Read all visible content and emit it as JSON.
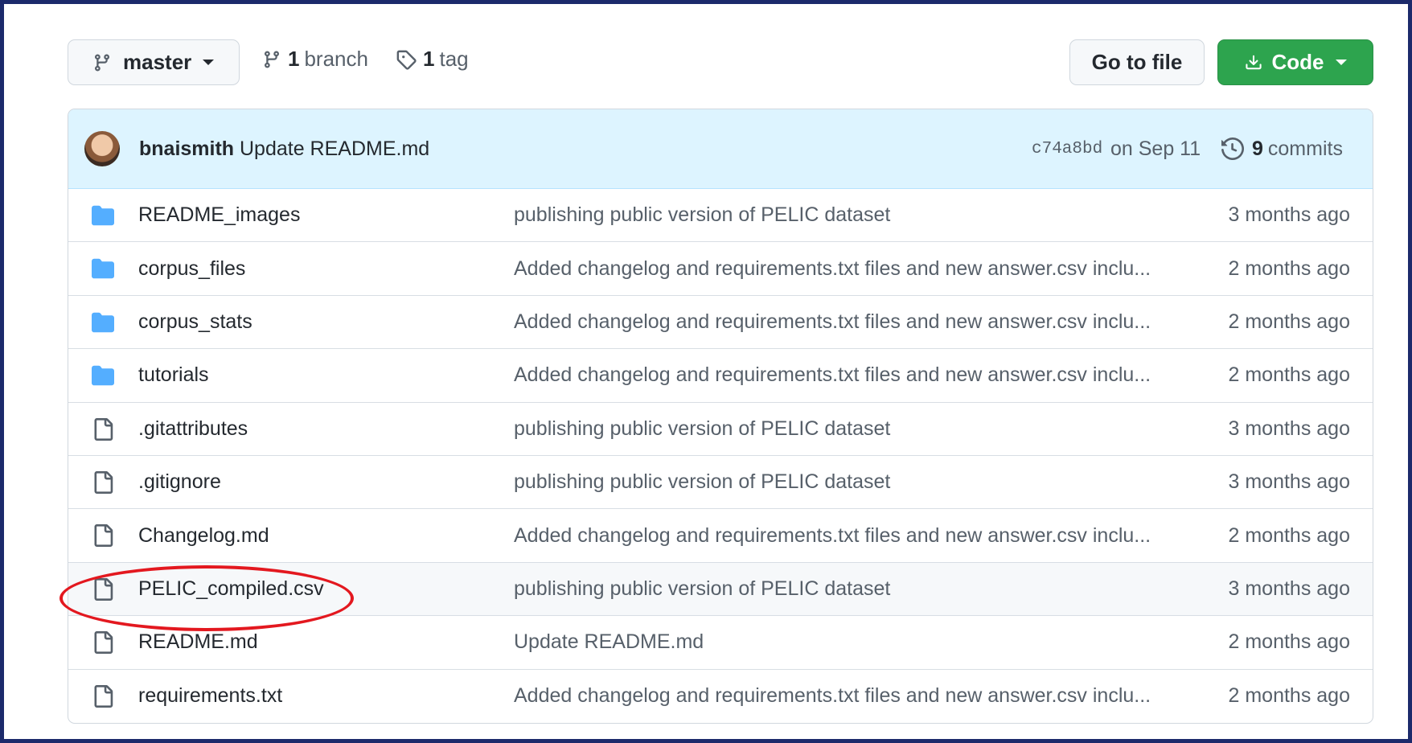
{
  "toolbar": {
    "branch_name": "master",
    "branch_count": "1",
    "branch_label": "branch",
    "tag_count": "1",
    "tag_label": "tag",
    "goto_label": "Go to file",
    "code_label": "Code",
    "accent_green": "#2da44e"
  },
  "commit": {
    "author": "bnaismith",
    "message": "Update README.md",
    "sha": "c74a8bd",
    "date": "on Sep 11",
    "commit_count": "9",
    "commits_label": "commits"
  },
  "files": [
    {
      "type": "folder",
      "name": "README_images",
      "message": "publishing public version of PELIC dataset",
      "age": "3 months ago"
    },
    {
      "type": "folder",
      "name": "corpus_files",
      "message": "Added changelog and requirements.txt files and new answer.csv inclu...",
      "age": "2 months ago"
    },
    {
      "type": "folder",
      "name": "corpus_stats",
      "message": "Added changelog and requirements.txt files and new answer.csv inclu...",
      "age": "2 months ago"
    },
    {
      "type": "folder",
      "name": "tutorials",
      "message": "Added changelog and requirements.txt files and new answer.csv inclu...",
      "age": "2 months ago"
    },
    {
      "type": "file",
      "name": ".gitattributes",
      "message": "publishing public version of PELIC dataset",
      "age": "3 months ago"
    },
    {
      "type": "file",
      "name": ".gitignore",
      "message": "publishing public version of PELIC dataset",
      "age": "3 months ago"
    },
    {
      "type": "file",
      "name": "Changelog.md",
      "message": "Added changelog and requirements.txt files and new answer.csv inclu...",
      "age": "2 months ago"
    },
    {
      "type": "file",
      "name": "PELIC_compiled.csv",
      "message": "publishing public version of PELIC dataset",
      "age": "3 months ago"
    },
    {
      "type": "file",
      "name": "README.md",
      "message": "Update README.md",
      "age": "2 months ago"
    },
    {
      "type": "file",
      "name": "requirements.txt",
      "message": "Added changelog and requirements.txt files and new answer.csv inclu...",
      "age": "2 months ago"
    }
  ],
  "annotation": {
    "highlighted_file": "PELIC_compiled.csv",
    "color": "#e3181f"
  }
}
